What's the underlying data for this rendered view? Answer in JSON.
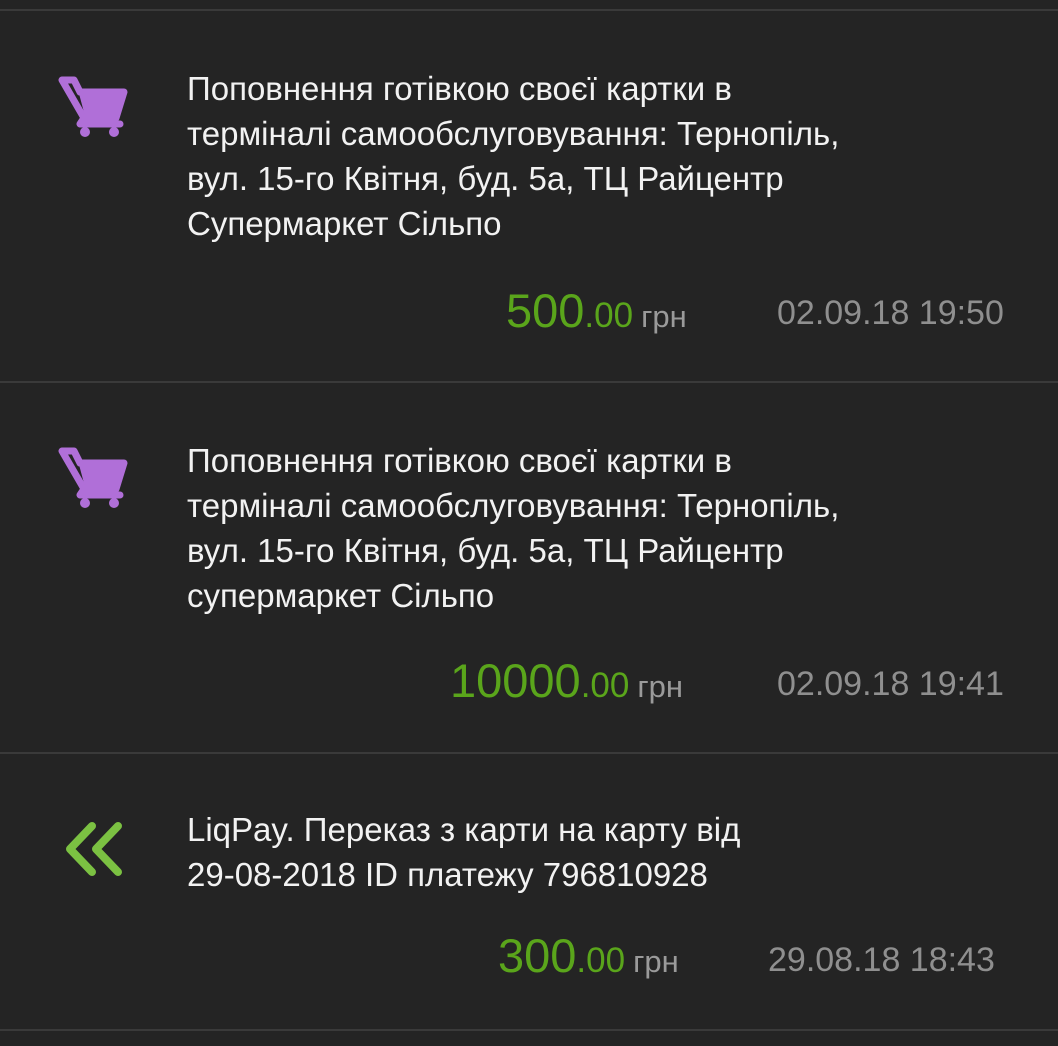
{
  "transactions": [
    {
      "icon": "shopping-cart-icon",
      "icon_color": "#b06fd8",
      "description_lines": [
        "Поповнення готівкою своєї картки в",
        "терміналі самообслуговування: Тернопіль,",
        "вул. 15-го Квітня, буд. 5а, ТЦ Райцентр",
        "Супермаркет Сільпо"
      ],
      "amount_int": "500",
      "amount_dec": ".00",
      "currency": "грн",
      "datetime": "02.09.18 19:50"
    },
    {
      "icon": "shopping-cart-icon",
      "icon_color": "#b06fd8",
      "description_lines": [
        "Поповнення готівкою своєї картки в",
        "терміналі самообслуговування: Тернопіль,",
        "вул. 15-го Квітня, буд. 5а, ТЦ Райцентр",
        "супермаркет Сільпо"
      ],
      "amount_int": "10000",
      "amount_dec": ".00",
      "currency": "грн",
      "datetime": "02.09.18 19:41"
    },
    {
      "icon": "double-chevron-left-icon",
      "icon_color": "#7bc142",
      "description_lines": [
        "LiqPay. Переказ з карти на карту від",
        "29-08-2018 ID платежу 796810928"
      ],
      "amount_int": "300",
      "amount_dec": ".00",
      "currency": "грн",
      "datetime": "29.08.18 18:43"
    }
  ],
  "colors": {
    "background": "#242424",
    "amount": "#5aa51b",
    "muted_text": "#8f8f8f",
    "divider": "#3a3a3a"
  }
}
